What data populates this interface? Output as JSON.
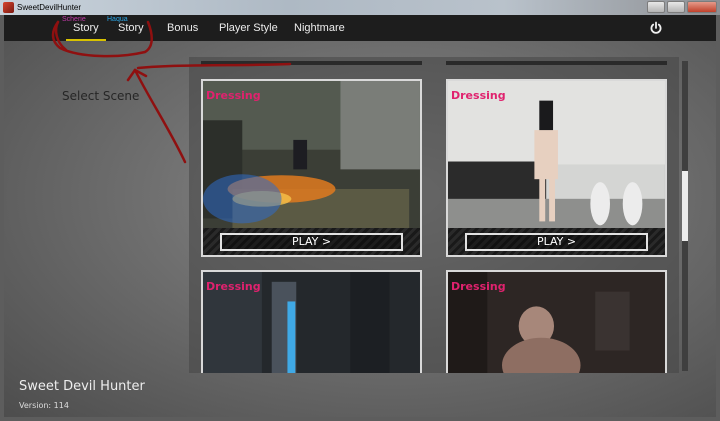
{
  "window": {
    "title": "SweetDevilHunter"
  },
  "nav": {
    "items": [
      {
        "label": "Story",
        "sublabel": "Scherie",
        "sublabel_color": "#c23aa8"
      },
      {
        "label": "Story",
        "sublabel": "Haqua",
        "sublabel_color": "#2aa7e8"
      },
      {
        "label": "Bonus"
      },
      {
        "label": "Player Style"
      },
      {
        "label": "Nightmare"
      }
    ],
    "active_index": 0,
    "accent_color": "#d8c200",
    "power_icon": "power-icon"
  },
  "section_label": "Select Scene",
  "scenes": [
    {
      "tag": "Dressing",
      "play_label": "PLAY >"
    },
    {
      "tag": "Dressing",
      "play_label": "PLAY >"
    },
    {
      "tag": "Dressing"
    },
    {
      "tag": "Dressing"
    }
  ],
  "footer": {
    "title": "Sweet Devil Hunter",
    "version": "Version: 114"
  },
  "colors": {
    "tag": "#e0226e",
    "annotation": "#8f1010"
  }
}
